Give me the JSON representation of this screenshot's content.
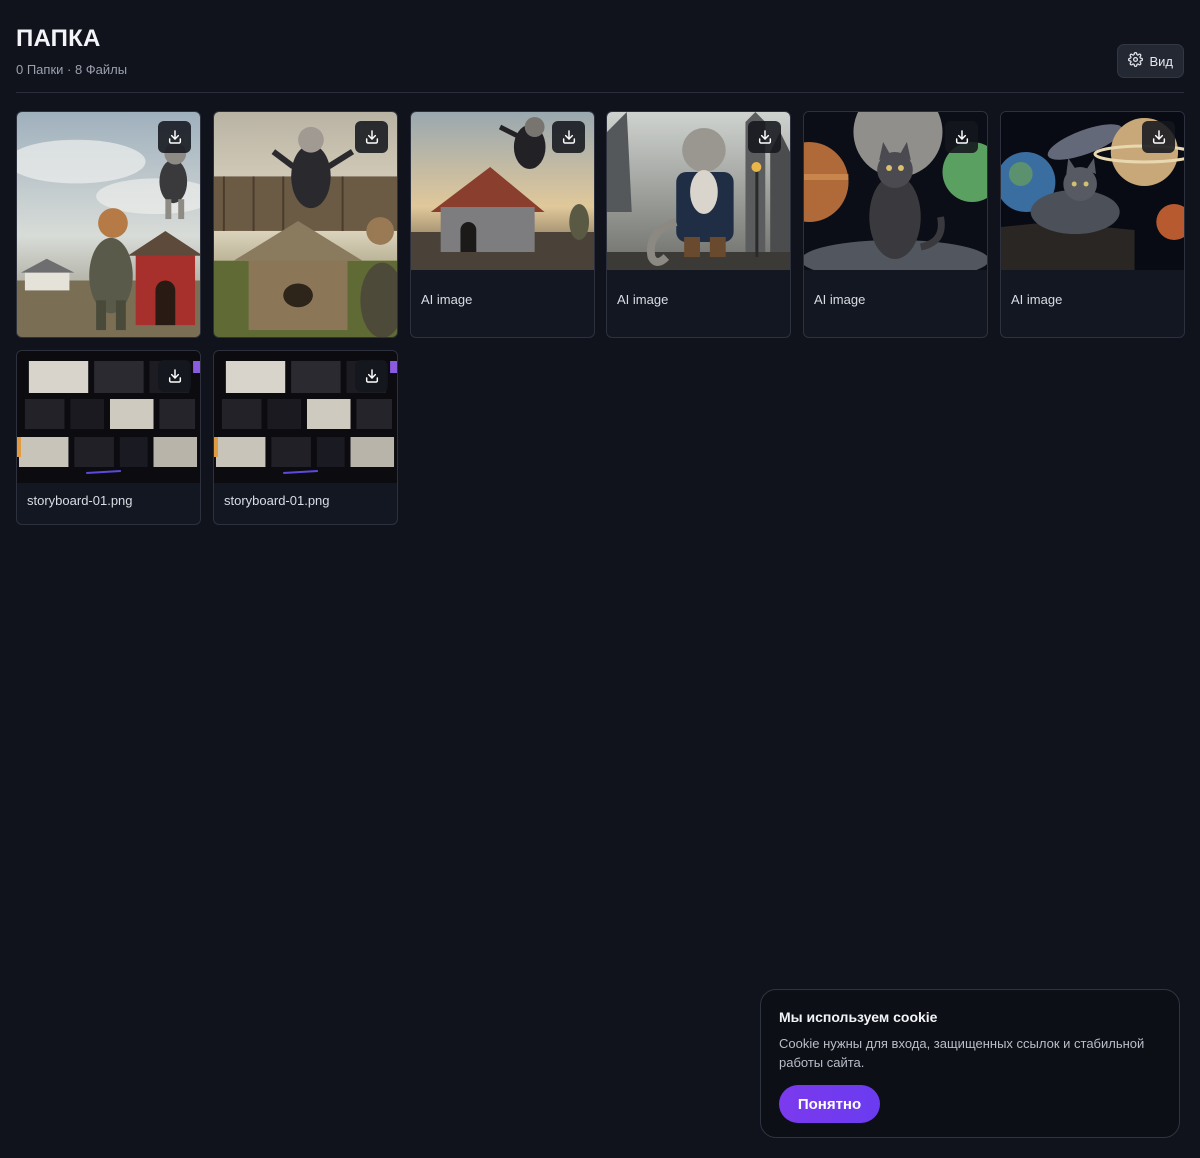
{
  "header": {
    "title": "ПАПКА",
    "subtitle": "0 Папки · 8 Файлы",
    "view_button_label": "Вид"
  },
  "files": [
    {
      "caption": "",
      "thumbnail": "dog and cat dancing by red doghouse"
    },
    {
      "caption": "",
      "thumbnail": "cat in leather jacket jumping over doghouse"
    },
    {
      "caption": "AI image",
      "thumbnail": "cat leaping off doghouse at sunset"
    },
    {
      "caption": "AI image",
      "thumbnail": "cat in coat on castle street"
    },
    {
      "caption": "AI image",
      "thumbnail": "cat with planets in space"
    },
    {
      "caption": "AI image",
      "thumbnail": "cat resting on rock among planets"
    },
    {
      "caption": "storyboard-01.png",
      "thumbnail": "storyboard sketches"
    },
    {
      "caption": "storyboard-01.png",
      "thumbnail": "storyboard sketches"
    }
  ],
  "icons": {
    "view": "gear-icon",
    "download": "download-icon"
  },
  "cookie": {
    "title": "Мы используем cookie",
    "text": "Cookie нужны для входа, защищенных ссылок и стабильной работы сайта.",
    "button_label": "Понятно"
  },
  "colors": {
    "background": "#10131b",
    "accent": "#7c3aed"
  }
}
